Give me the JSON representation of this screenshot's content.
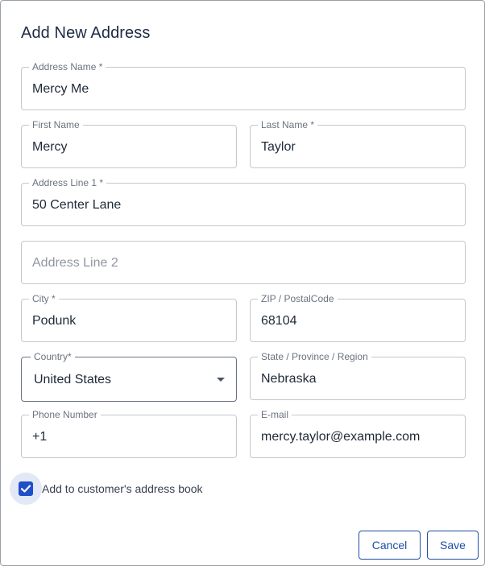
{
  "dialog": {
    "title": "Add New Address"
  },
  "fields": {
    "address_name": {
      "label": "Address Name *",
      "value": "Mercy Me"
    },
    "first_name": {
      "label": "First Name",
      "value": "Mercy"
    },
    "last_name": {
      "label": "Last Name *",
      "value": "Taylor"
    },
    "address_line_1": {
      "label": "Address Line 1 *",
      "value": "50 Center Lane"
    },
    "address_line_2": {
      "placeholder": "Address Line 2"
    },
    "city": {
      "label": "City *",
      "value": "Podunk"
    },
    "zip": {
      "label": "ZIP / PostalCode",
      "value": "68104"
    },
    "country": {
      "label": "Country*",
      "value": "United States"
    },
    "state": {
      "label": "State / Province / Region",
      "value": "Nebraska"
    },
    "phone": {
      "label": "Phone Number",
      "value": "+1"
    },
    "email": {
      "label": "E-mail",
      "value": "mercy.taylor@example.com"
    }
  },
  "address_book": {
    "label": "Add to customer's address book",
    "checked": true
  },
  "actions": {
    "cancel_label": "Cancel",
    "save_label": "Save"
  },
  "colors": {
    "accent": "#1f4ec9",
    "button_text": "#1f4ea3"
  },
  "icons": {
    "dropdown": "chevron-down-icon",
    "check": "check-icon"
  }
}
